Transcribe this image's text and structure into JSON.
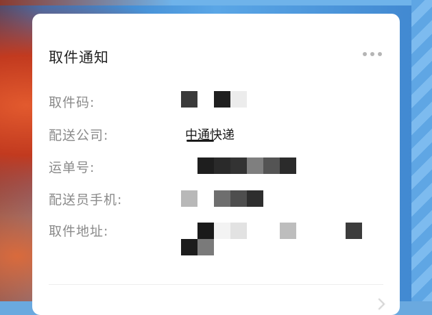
{
  "card": {
    "title": "取件通知",
    "more_icon": "more-horizontal-icon"
  },
  "fields": {
    "pickup_code": {
      "label": "取件码:"
    },
    "courier_company": {
      "label": "配送公司:",
      "value": "中通快递"
    },
    "tracking_number": {
      "label": "运单号:"
    },
    "courier_phone": {
      "label": "配送员手机:"
    },
    "pickup_address": {
      "label": "取件地址:"
    }
  },
  "colors": {
    "label": "#8a8a8a",
    "value": "#1a1a1a",
    "card": "#ffffff",
    "more_dots": "#b5b5b5"
  }
}
